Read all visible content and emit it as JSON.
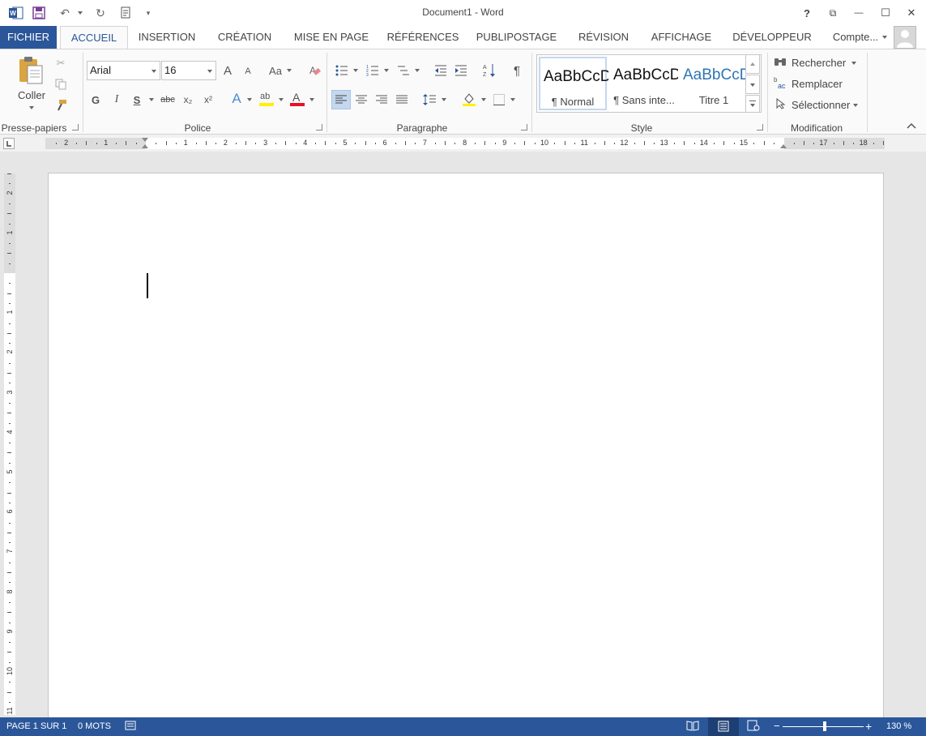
{
  "titlebar": {
    "title": "Document1 - Word",
    "help": "?",
    "restore_ribbon": "⧉",
    "minimize": "—",
    "maximize": "☐",
    "close": "✕"
  },
  "tabs": [
    {
      "label": "FICHIER"
    },
    {
      "label": "ACCUEIL"
    },
    {
      "label": "INSERTION"
    },
    {
      "label": "CRÉATION"
    },
    {
      "label": "MISE EN PAGE"
    },
    {
      "label": "RÉFÉRENCES"
    },
    {
      "label": "PUBLIPOSTAGE"
    },
    {
      "label": "RÉVISION"
    },
    {
      "label": "AFFICHAGE"
    },
    {
      "label": "DÉVELOPPEUR"
    }
  ],
  "account": {
    "label": "Compte..."
  },
  "clipboard": {
    "paste_label": "Coller",
    "group_label": "Presse-papiers"
  },
  "font": {
    "name": "Arial",
    "size": "16",
    "group_label": "Police",
    "bold": "G",
    "italic": "I",
    "underline": "S",
    "strike": "abc",
    "subscript": "x₂",
    "superscript": "x²",
    "grow": "A",
    "shrink": "A",
    "case": "Aa",
    "effects": "A",
    "highlight": "ab",
    "color": "A"
  },
  "paragraph": {
    "group_label": "Paragraphe",
    "pilcrow": "¶"
  },
  "styles": {
    "group_label": "Style",
    "items": [
      {
        "sample": "AaBbCcDc",
        "name": "¶ Normal"
      },
      {
        "sample": "AaBbCcDc",
        "name": "¶ Sans inte..."
      },
      {
        "sample": "AaBbCcD",
        "name": "Titre 1"
      }
    ]
  },
  "editing": {
    "group_label": "Modification",
    "find": "Rechercher",
    "replace": "Remplacer",
    "select": "Sélectionner"
  },
  "ruler": {
    "labels": [
      "2",
      "1",
      "1",
      "2",
      "3",
      "4",
      "5",
      "6",
      "7",
      "8",
      "9",
      "10",
      "11",
      "12",
      "13",
      "14",
      "15",
      "17",
      "18"
    ],
    "vlabels": [
      "2",
      "1",
      "1",
      "2",
      "3",
      "4",
      "5",
      "6",
      "7",
      "8",
      "9",
      "10",
      "11"
    ]
  },
  "status": {
    "page": "PAGE 1 SUR 1",
    "words": "0 MOTS",
    "zoom_minus": "−",
    "zoom_plus": "+",
    "zoom": "130 %"
  },
  "colors": {
    "accent": "#2b579a",
    "font_color": "#e81123",
    "highlight": "#fff100"
  }
}
